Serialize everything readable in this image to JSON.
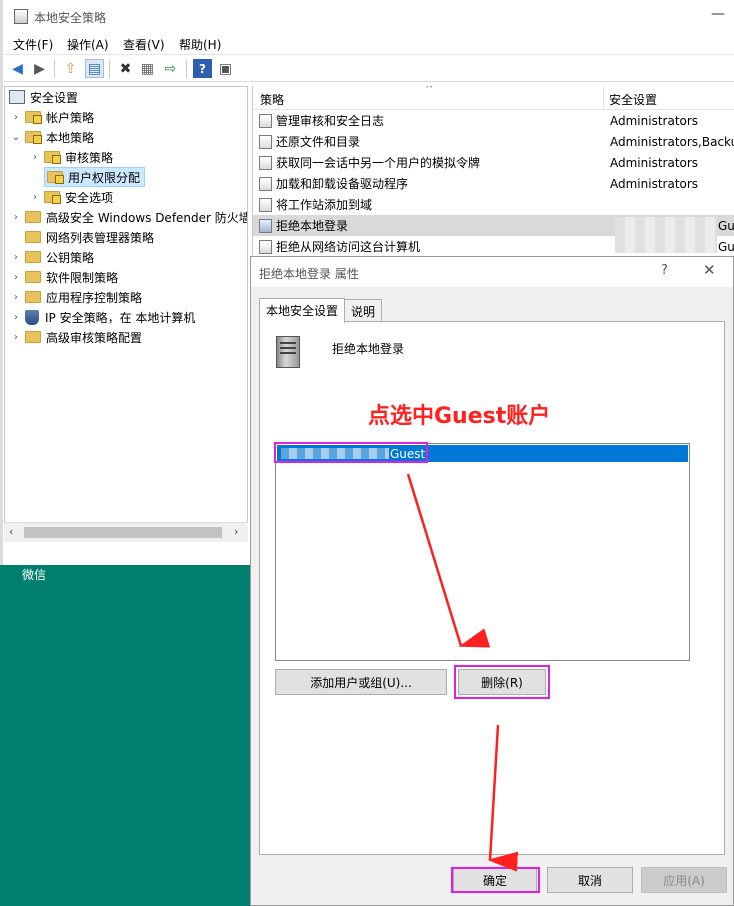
{
  "window": {
    "title": "本地安全策略",
    "minimize": "—"
  },
  "menu": {
    "file": "文件(F)",
    "action": "操作(A)",
    "view": "查看(V)",
    "help": "帮助(H)"
  },
  "toolbar": {
    "back": "◀",
    "forward": "▶",
    "up": "⇧",
    "show_hide": "▤",
    "delete": "✖",
    "properties": "▦",
    "export": "⇨",
    "help": "?",
    "view": "▣"
  },
  "tree": {
    "root": "安全设置",
    "items": [
      {
        "label": "帐户策略"
      },
      {
        "label": "本地策略"
      },
      {
        "label": "审核策略"
      },
      {
        "label": "用户权限分配"
      },
      {
        "label": "安全选项"
      },
      {
        "label": "高级安全 Windows Defender 防火墙"
      },
      {
        "label": "网络列表管理器策略"
      },
      {
        "label": "公钥策略"
      },
      {
        "label": "软件限制策略"
      },
      {
        "label": "应用程序控制策略"
      },
      {
        "label": "IP 安全策略，在 本地计算机"
      },
      {
        "label": "高级审核策略配置"
      }
    ]
  },
  "desktop": {
    "label": "微信"
  },
  "list": {
    "col_policy": "策略",
    "col_security": "安全设置",
    "sort_arrow": "^",
    "rows": [
      {
        "name": "管理审核和安全日志",
        "value": "Administrators"
      },
      {
        "name": "还原文件和目录",
        "value": "Administrators,Backup"
      },
      {
        "name": "获取同一会话中另一个用户的模拟令牌",
        "value": "Administrators"
      },
      {
        "name": "加载和卸载设备驱动程序",
        "value": "Administrators"
      },
      {
        "name": "将工作站添加到域",
        "value": ""
      },
      {
        "name": "拒绝本地登录",
        "value": "Gu"
      },
      {
        "name": "拒绝从网络访问这台计算机",
        "value": "Gu"
      }
    ]
  },
  "dialog": {
    "title": "拒绝本地登录 属性",
    "help": "?",
    "close": "✕",
    "tabs": {
      "local": "本地安全设置",
      "explain": "说明"
    },
    "heading": "拒绝本地登录",
    "annotation": "点选中Guest账户",
    "user": "Guest",
    "add_button": "添加用户或组(U)...",
    "remove_button": "删除(R)",
    "ok_button": "确定",
    "cancel_button": "取消",
    "apply_button": "应用(A)"
  },
  "colors": {
    "selection": "#0078d7",
    "annotation": "#ff2020",
    "highlight_box": "#e020e0",
    "desktop": "#007f6e"
  }
}
